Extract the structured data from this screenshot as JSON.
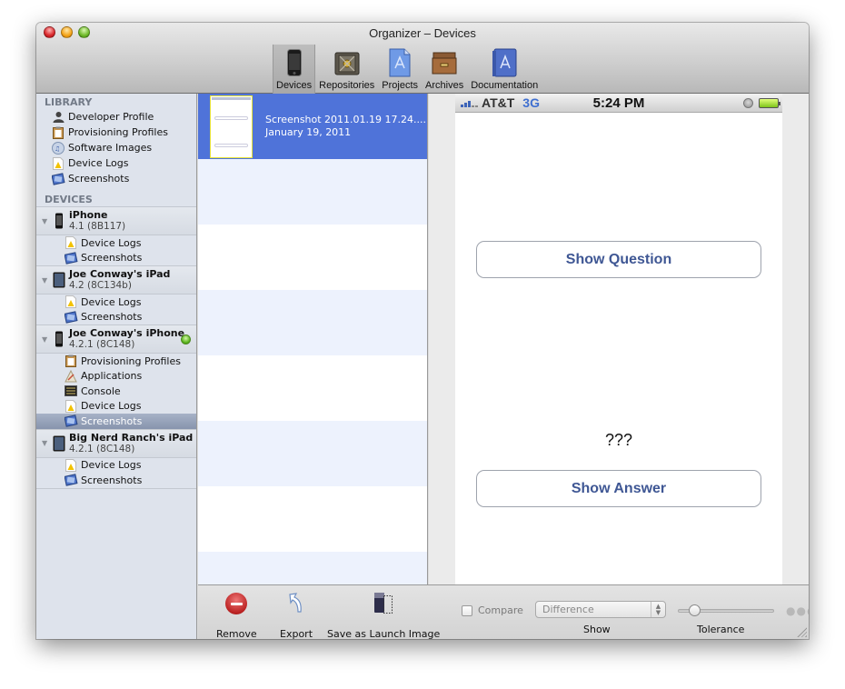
{
  "window": {
    "title": "Organizer – Devices",
    "controls": [
      "close",
      "minimize",
      "zoom"
    ]
  },
  "toolbar": {
    "items": [
      {
        "label": "Devices",
        "icon": "iphone-icon",
        "active": true
      },
      {
        "label": "Repositories",
        "icon": "vault-icon",
        "active": false
      },
      {
        "label": "Projects",
        "icon": "project-document-icon",
        "active": false
      },
      {
        "label": "Archives",
        "icon": "archive-drawer-icon",
        "active": false
      },
      {
        "label": "Documentation",
        "icon": "documentation-book-icon",
        "active": false
      }
    ]
  },
  "sidebar": {
    "library_header": "LIBRARY",
    "library": [
      {
        "label": "Developer Profile",
        "icon": "person-icon"
      },
      {
        "label": "Provisioning Profiles",
        "icon": "clipboard-icon"
      },
      {
        "label": "Software Images",
        "icon": "software-image-icon"
      },
      {
        "label": "Device Logs",
        "icon": "warning-log-icon"
      },
      {
        "label": "Screenshots",
        "icon": "screenshots-icon"
      }
    ],
    "devices_header": "DEVICES",
    "devices": [
      {
        "name": "iPhone",
        "version": "4.1 (8B117)",
        "icon": "iphone-device-icon",
        "connected": false,
        "items": [
          {
            "label": "Device Logs",
            "icon": "warning-log-icon"
          },
          {
            "label": "Screenshots",
            "icon": "screenshots-icon"
          }
        ]
      },
      {
        "name": "Joe Conway's iPad",
        "version": "4.2 (8C134b)",
        "icon": "ipad-device-icon",
        "connected": false,
        "items": [
          {
            "label": "Device Logs",
            "icon": "warning-log-icon"
          },
          {
            "label": "Screenshots",
            "icon": "screenshots-icon"
          }
        ]
      },
      {
        "name": "Joe Conway's iPhone",
        "version": "4.2.1 (8C148)",
        "icon": "iphone-device-icon",
        "connected": true,
        "items": [
          {
            "label": "Provisioning Profiles",
            "icon": "clipboard-icon"
          },
          {
            "label": "Applications",
            "icon": "applications-icon"
          },
          {
            "label": "Console",
            "icon": "console-icon"
          },
          {
            "label": "Device Logs",
            "icon": "warning-log-icon"
          },
          {
            "label": "Screenshots",
            "icon": "screenshots-icon",
            "selected": true
          }
        ]
      },
      {
        "name": "Big Nerd Ranch's iPad",
        "version": "4.2.1 (8C148)",
        "icon": "ipad-device-icon",
        "connected": false,
        "items": [
          {
            "label": "Device Logs",
            "icon": "warning-log-icon"
          },
          {
            "label": "Screenshots",
            "icon": "screenshots-icon"
          }
        ]
      }
    ]
  },
  "screenshots": [
    {
      "title": "Screenshot 2011.01.19 17.24....",
      "date": "January 19, 2011",
      "selected": true
    }
  ],
  "preview": {
    "statusbar": {
      "carrier": "AT&T",
      "network": "3G",
      "time": "5:24 PM"
    },
    "buttons": {
      "show_question": "Show Question",
      "show_answer": "Show Answer"
    },
    "question_label": "???"
  },
  "bottombar": {
    "remove_label": "Remove",
    "export_label": "Export",
    "launch_label": "Save as Launch Image",
    "compare_label": "Compare",
    "compare_checked": false,
    "show_value": "Difference",
    "show_label": "Show",
    "tolerance_label": "Tolerance",
    "tolerance_fraction": 0.12
  }
}
